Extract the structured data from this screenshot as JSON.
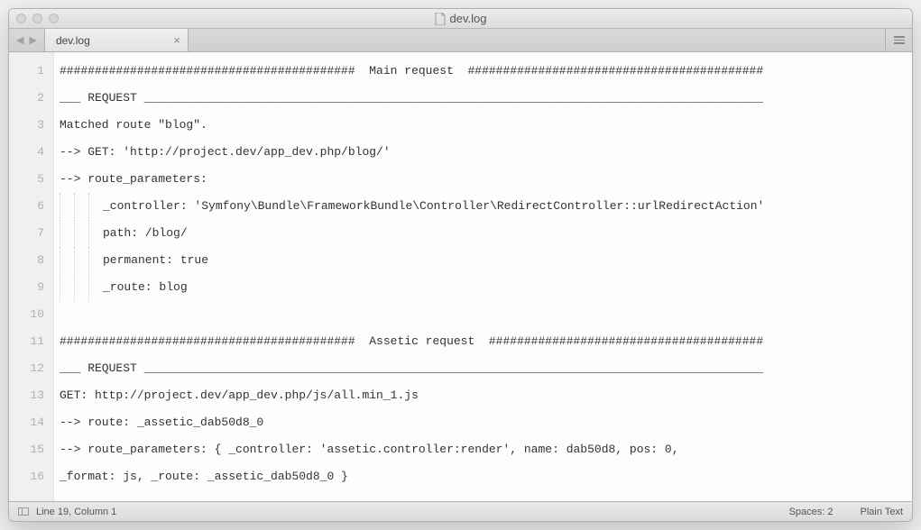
{
  "window": {
    "title": "dev.log"
  },
  "tab": {
    "name": "dev.log"
  },
  "lines": [
    "##########################################  Main request  ##########################################",
    "___ REQUEST ________________________________________________________________________________________",
    "Matched route \"blog\".",
    "--> GET: 'http://project.dev/app_dev.php/blog/'",
    "--> route_parameters:",
    "_controller: 'Symfony\\Bundle\\FrameworkBundle\\Controller\\RedirectController::urlRedirectAction'",
    "path: /blog/",
    "permanent: true",
    "_route: blog",
    "",
    "##########################################  Assetic request  #######################################",
    "___ REQUEST ________________________________________________________________________________________",
    "GET: http://project.dev/app_dev.php/js/all.min_1.js",
    "--> route: _assetic_dab50d8_0",
    "--> route_parameters: { _controller: 'assetic.controller:render', name: dab50d8, pos: 0,",
    "_format: js, _route: _assetic_dab50d8_0 }"
  ],
  "indents": [
    0,
    0,
    0,
    0,
    0,
    3,
    3,
    3,
    3,
    0,
    0,
    0,
    0,
    0,
    0,
    0
  ],
  "gutter": [
    "1",
    "2",
    "3",
    "4",
    "5",
    "6",
    "7",
    "8",
    "9",
    "10",
    "11",
    "12",
    "13",
    "14",
    "15",
    "16"
  ],
  "statusbar": {
    "position": "Line 19, Column 1",
    "spaces": "Spaces: 2",
    "syntax": "Plain Text"
  }
}
